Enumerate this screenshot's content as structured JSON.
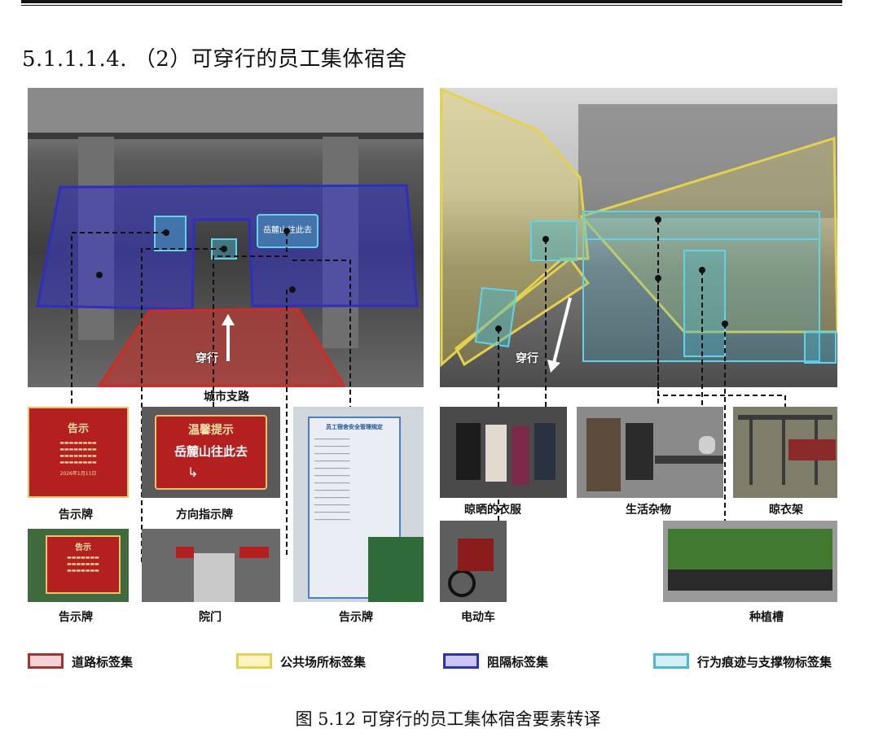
{
  "section": {
    "heading": "5.1.1.1.4. （2）可穿行的员工集体宿舍"
  },
  "left_photo": {
    "arrow_label": "穿行",
    "street_label": "城市支路",
    "sign_text": "岳麓山往此去"
  },
  "right_photo": {
    "arrow_label": "穿行"
  },
  "thumbnails": {
    "notice_board_1": {
      "caption": "告示牌",
      "sign_title": "告示",
      "sign_date": "2026年1月11日"
    },
    "direction_sign": {
      "caption": "方向指示牌",
      "sign_title": "温馨提示",
      "sign_text": "岳麓山往此去"
    },
    "rules_board": {
      "caption": "告示牌",
      "sign_title": "员工宿舍安全管理规定"
    },
    "notice_board_2": {
      "caption": "告示牌",
      "sign_title": "告示"
    },
    "courtyard_gate": {
      "caption": "院门"
    },
    "drying_clothes": {
      "caption": "晾晒的衣服"
    },
    "household_items": {
      "caption": "生活杂物"
    },
    "drying_rack": {
      "caption": "晾衣架"
    },
    "e_bike": {
      "caption": "电动车"
    },
    "planter": {
      "caption": "种植槽"
    }
  },
  "legend": [
    {
      "label": "道路标签集",
      "stroke": "#a8322c",
      "fill": "#f3d3d6"
    },
    {
      "label": "公共场所标签集",
      "stroke": "#e3d24a",
      "fill": "#fbf3c4"
    },
    {
      "label": "阻隔标签集",
      "stroke": "#2f2fbf",
      "fill": "#c9c6f2"
    },
    {
      "label": "行为痕迹与支撑物标签集",
      "stroke": "#4bb9d2",
      "fill": "#d3eef4"
    }
  ],
  "figure": {
    "caption": "图 5.12 可穿行的员工集体宿舍要素转译"
  }
}
